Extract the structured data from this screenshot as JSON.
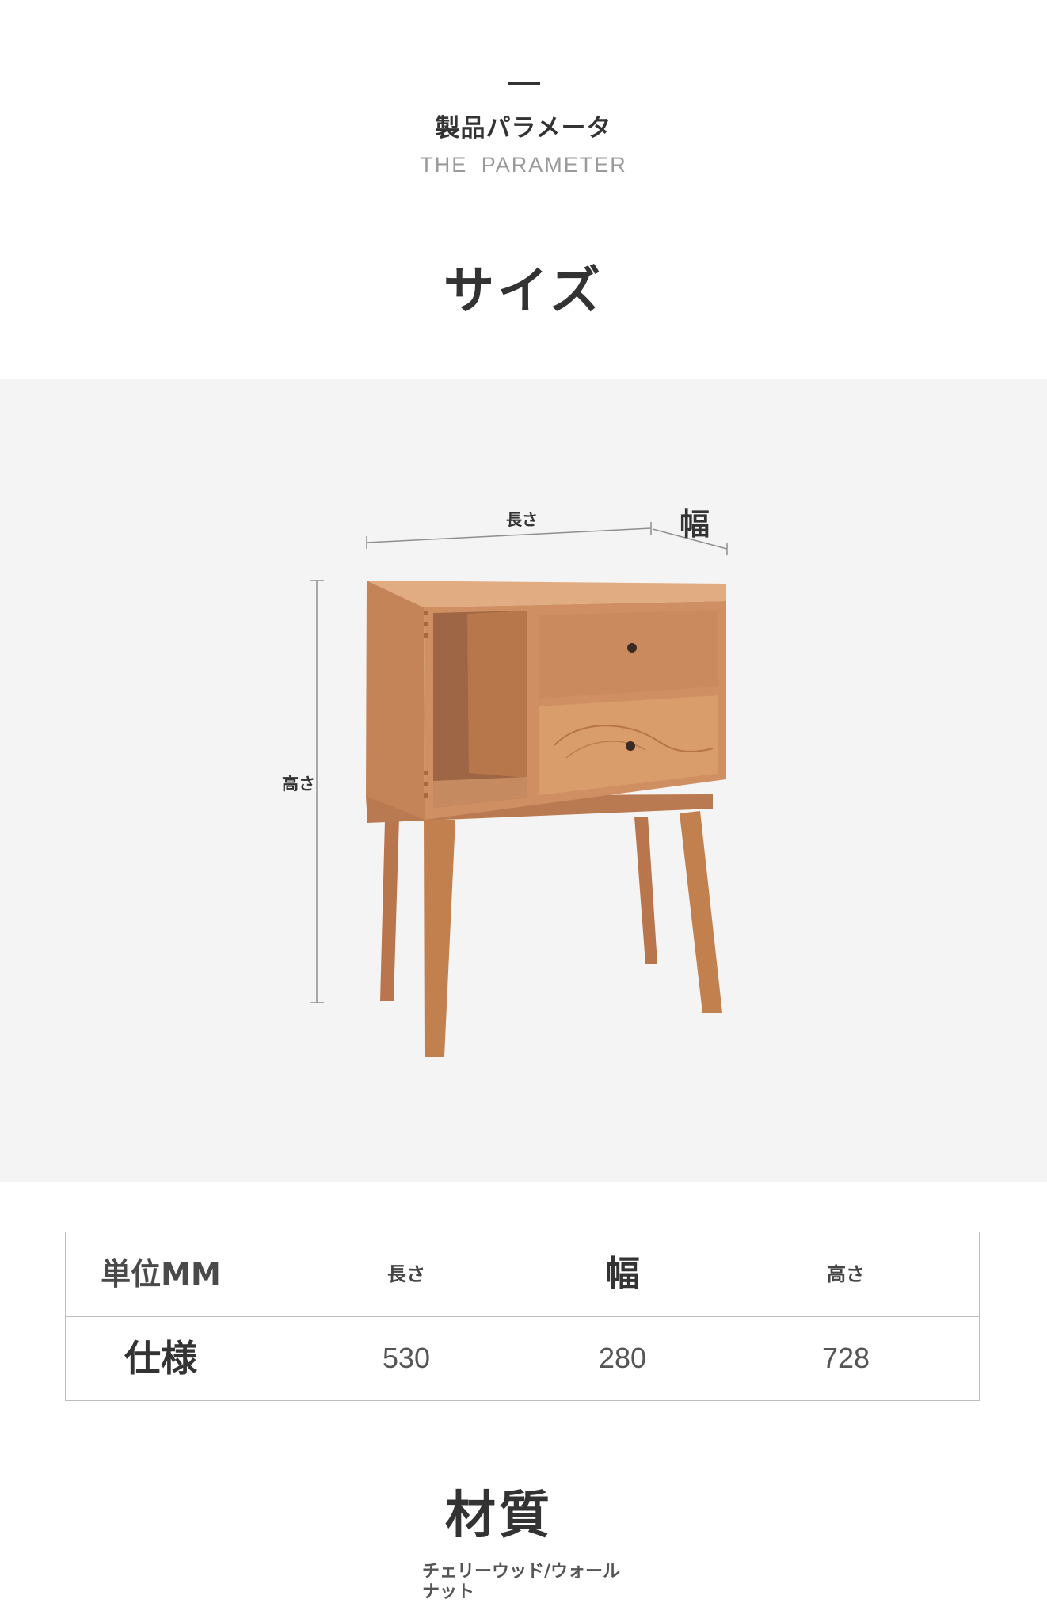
{
  "header": {
    "title_ja": "製品パラメータ",
    "title_en": "THE  PARAMETER"
  },
  "size_section": {
    "title": "サイズ",
    "dimension_labels": {
      "length": "長さ",
      "width": "幅",
      "height": "高さ"
    }
  },
  "spec_table": {
    "header": [
      "単位MM",
      "長さ",
      "幅",
      "高さ"
    ],
    "row": [
      "仕様",
      "530",
      "280",
      "728"
    ]
  },
  "material_section": {
    "title": "材質",
    "description": "チェリーウッド/ウォールナット"
  },
  "colors": {
    "band_background": "#f4f4f5",
    "wood_light": "#d8a27a",
    "wood_mid": "#c98c62",
    "wood_dark": "#9e6440",
    "text_dark": "#333333",
    "text_gray": "#9a9a9a"
  }
}
